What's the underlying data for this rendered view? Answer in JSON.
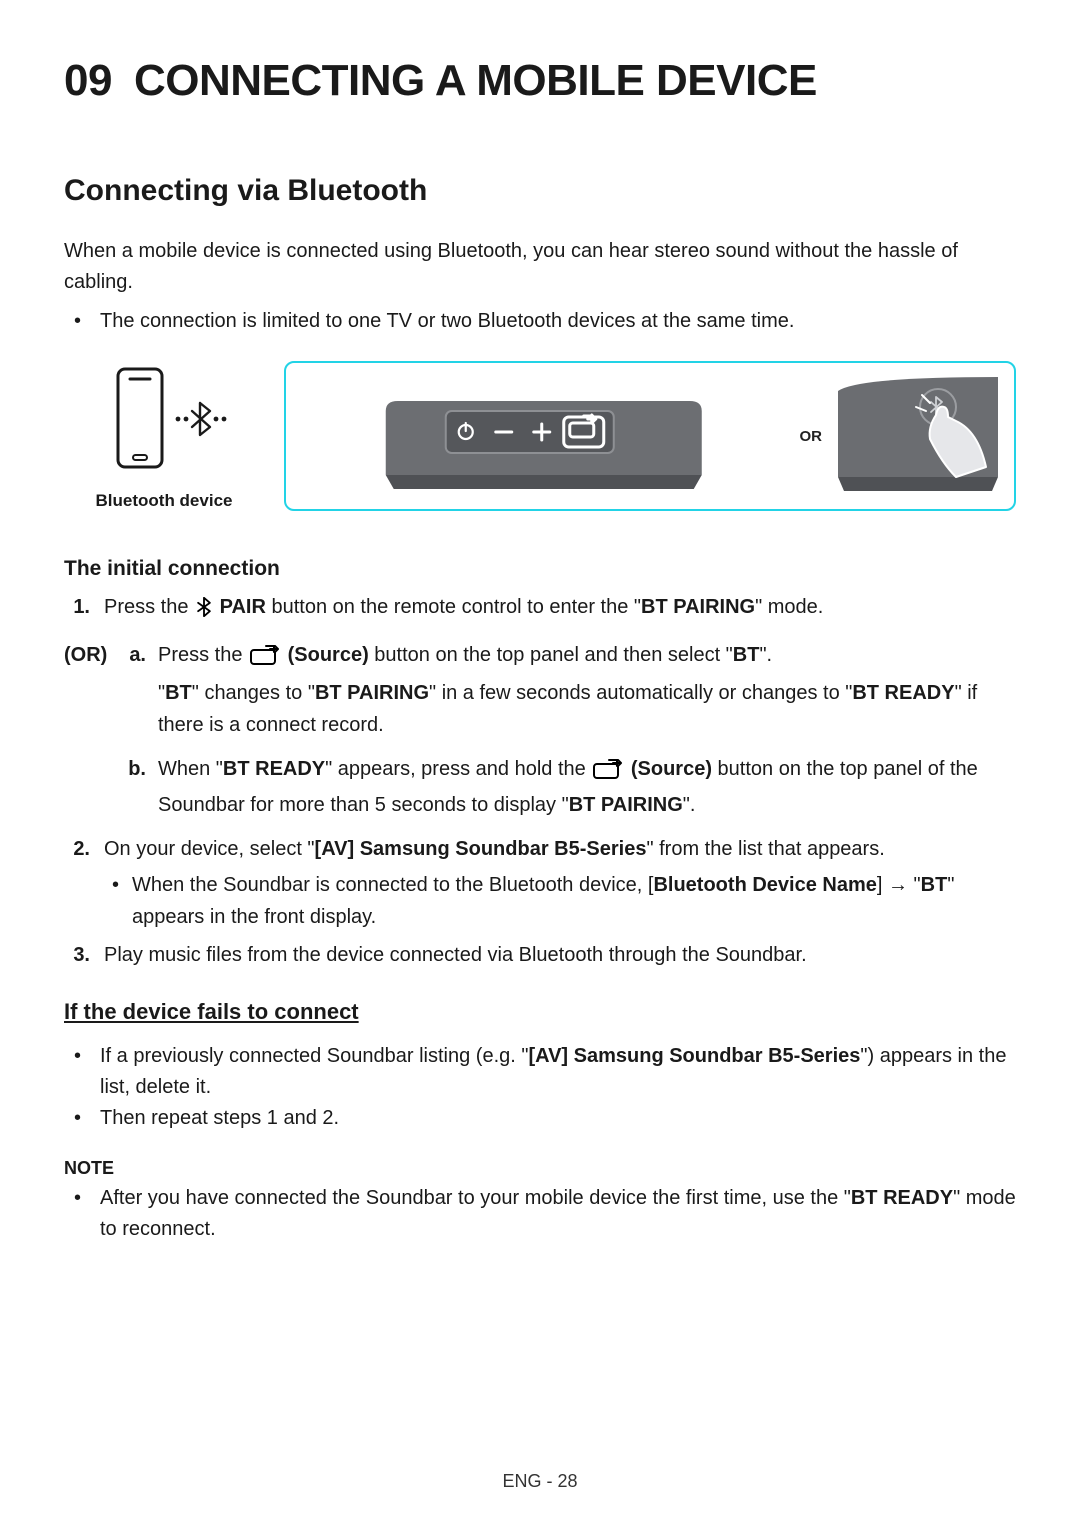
{
  "header": {
    "section_number": "09",
    "section_title": "CONNECTING A MOBILE DEVICE"
  },
  "subheading": "Connecting via Bluetooth",
  "intro": "When a mobile device is connected using Bluetooth, you can hear stereo sound without the hassle of cabling.",
  "intro_bullet": "The connection is limited to one TV or two Bluetooth devices at the same time.",
  "phone_label": "Bluetooth device",
  "or_label": "OR",
  "initial_heading": "The initial connection",
  "step1": {
    "num": "1.",
    "pre": "Press the ",
    "pair": " PAIR",
    "post": " button on the remote control to enter the \"",
    "mode": "BT PAIRING",
    "end": "\" mode."
  },
  "or_text": "(OR)",
  "sub_a": {
    "label": "a.",
    "l1_pre": "Press the ",
    "src": " (Source)",
    "l1_post": " button on the top panel and then select \"",
    "bt": "BT",
    "l1_end": "\".",
    "l2_p1": "\"",
    "l2_bt": "BT",
    "l2_p2": "\" changes to \"",
    "l2_pair": "BT PAIRING",
    "l2_p3": "\" in a few seconds automatically or changes to \"",
    "l2_ready": "BT READY",
    "l2_p4": "\" if there is a connect record."
  },
  "sub_b": {
    "label": "b.",
    "p1": "When \"",
    "ready": "BT READY",
    "p2": "\" appears, press and hold the ",
    "src": " (Source)",
    "p3": " button on the top panel of the Soundbar for more than 5 seconds to display \"",
    "pair": "BT PAIRING",
    "p4": "\"."
  },
  "step2": {
    "num": "2.",
    "p1": "On your device, select \"",
    "dev": "[AV] Samsung Soundbar B5-Series",
    "p2": "\" from the list that appears.",
    "bullet_p1": "When the Soundbar is connected to the Bluetooth device, [",
    "bullet_name": "Bluetooth Device Name",
    "bullet_p2": "] → \"",
    "bullet_bt": "BT",
    "bullet_p3": "\" appears in the front display."
  },
  "step3": {
    "num": "3.",
    "text": "Play music files from the device connected via Bluetooth through the Soundbar."
  },
  "fail_heading": "If the device fails to connect",
  "fail_b1": {
    "p1": "If a previously connected Soundbar listing (e.g. \"",
    "dev": "[AV] Samsung Soundbar B5-Series",
    "p2": "\") appears in the list, delete it."
  },
  "fail_b2": "Then repeat steps 1 and 2.",
  "note_label": "NOTE",
  "note_b1": {
    "p1": "After you have connected the Soundbar to your mobile device the first time, use the \"",
    "ready": "BT READY",
    "p2": "\" mode to reconnect."
  },
  "footer": "ENG - 28"
}
